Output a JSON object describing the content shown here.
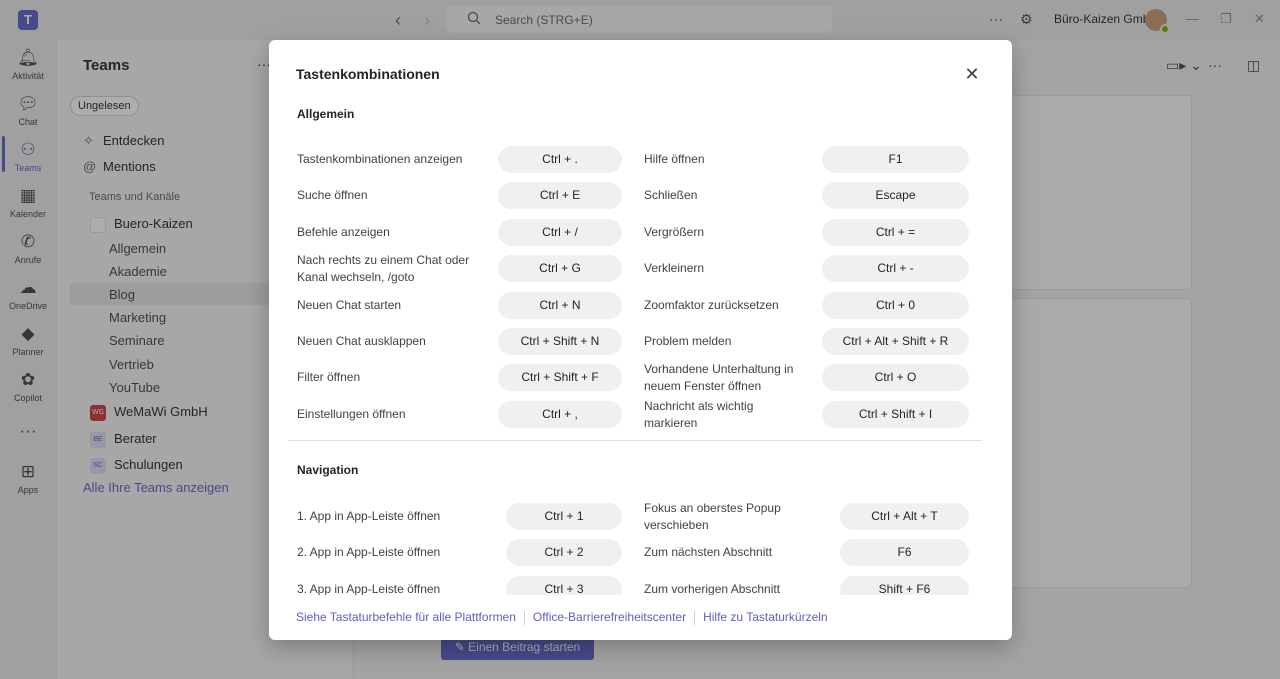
{
  "titlebar": {
    "logo": "T",
    "search_placeholder": "Search (STRG+E)",
    "org_name": "Büro-Kaizen GmbH"
  },
  "appbar": {
    "items": [
      {
        "label": "Aktivität",
        "icon": "bell-icon"
      },
      {
        "label": "Chat",
        "icon": "chat-icon"
      },
      {
        "label": "Teams",
        "icon": "teams-icon"
      },
      {
        "label": "Kalender",
        "icon": "calendar-icon"
      },
      {
        "label": "Anrufe",
        "icon": "phone-icon"
      },
      {
        "label": "OneDrive",
        "icon": "cloud-icon"
      },
      {
        "label": "Planner",
        "icon": "planner-icon"
      },
      {
        "label": "Copilot",
        "icon": "copilot-icon"
      },
      {
        "label": "Apps",
        "icon": "apps-icon"
      }
    ]
  },
  "sidebar": {
    "title": "Teams",
    "filter_chip": "Ungelesen",
    "entdecken": "Entdecken",
    "mentions": "Mentions",
    "section": "Teams und Kanäle",
    "team1": "Buero-Kaizen",
    "channels": [
      "Allgemein",
      "Akademie",
      "Blog",
      "Marketing",
      "Seminare",
      "Vertrieb",
      "YouTube"
    ],
    "team2": "WeMaWi GmbH",
    "team2_abbr": "WG",
    "team3": "Berater",
    "team3_abbr": "BE",
    "team4": "Schulungen",
    "team4_abbr": "SC",
    "all_teams_link": "Alle Ihre Teams anzeigen"
  },
  "main": {
    "start_post_button": "Einen Beitrag starten"
  },
  "dialog": {
    "title": "Tastenkombinationen",
    "sections": {
      "general": {
        "title": "Allgemein",
        "left": [
          {
            "label": "Tastenkombinationen anzeigen",
            "key": "Ctrl + ."
          },
          {
            "label": "Suche öffnen",
            "key": "Ctrl + E"
          },
          {
            "label": "Befehle anzeigen",
            "key": "Ctrl + /"
          },
          {
            "label": "Nach rechts zu einem Chat oder Kanal wechseln, /goto",
            "key": "Ctrl + G"
          },
          {
            "label": "Neuen Chat starten",
            "key": "Ctrl + N"
          },
          {
            "label": "Neuen Chat ausklappen",
            "key": "Ctrl + Shift + N"
          },
          {
            "label": "Filter öffnen",
            "key": "Ctrl + Shift + F"
          },
          {
            "label": "Einstellungen öffnen",
            "key": "Ctrl + ,"
          }
        ],
        "right": [
          {
            "label": "Hilfe öffnen",
            "key": "F1"
          },
          {
            "label": "Schließen",
            "key": "Escape"
          },
          {
            "label": "Vergrößern",
            "key": "Ctrl + ="
          },
          {
            "label": "Verkleinern",
            "key": "Ctrl + -"
          },
          {
            "label": "Zoomfaktor zurücksetzen",
            "key": "Ctrl + 0"
          },
          {
            "label": "Problem melden",
            "key": "Ctrl + Alt + Shift + R"
          },
          {
            "label": "Vorhandene Unterhaltung in neuem Fenster öffnen",
            "key": "Ctrl + O"
          },
          {
            "label": "Nachricht als wichtig markieren",
            "key": "Ctrl + Shift + I"
          }
        ]
      },
      "navigation": {
        "title": "Navigation",
        "left": [
          {
            "label": "1. App in App-Leiste öffnen",
            "key": "Ctrl + 1"
          },
          {
            "label": "2. App in App-Leiste öffnen",
            "key": "Ctrl + 2"
          },
          {
            "label": "3. App in App-Leiste öffnen",
            "key": "Ctrl + 3"
          }
        ],
        "right": [
          {
            "label": "Fokus an oberstes Popup verschieben",
            "key": "Ctrl + Alt + T"
          },
          {
            "label": "Zum nächsten Abschnitt",
            "key": "F6"
          },
          {
            "label": "Zum vorherigen Abschnitt",
            "key": "Shift + F6"
          }
        ]
      }
    },
    "footer": {
      "link1": "Siehe Tastaturbefehle für alle Plattformen",
      "link2": "Office-Barrierefreiheitscenter",
      "link3": "Hilfe zu Tastaturkürzeln"
    }
  },
  "colors": {
    "accent": "#5b5fc7",
    "overlay": "rgba(40,40,40,0.38)"
  }
}
